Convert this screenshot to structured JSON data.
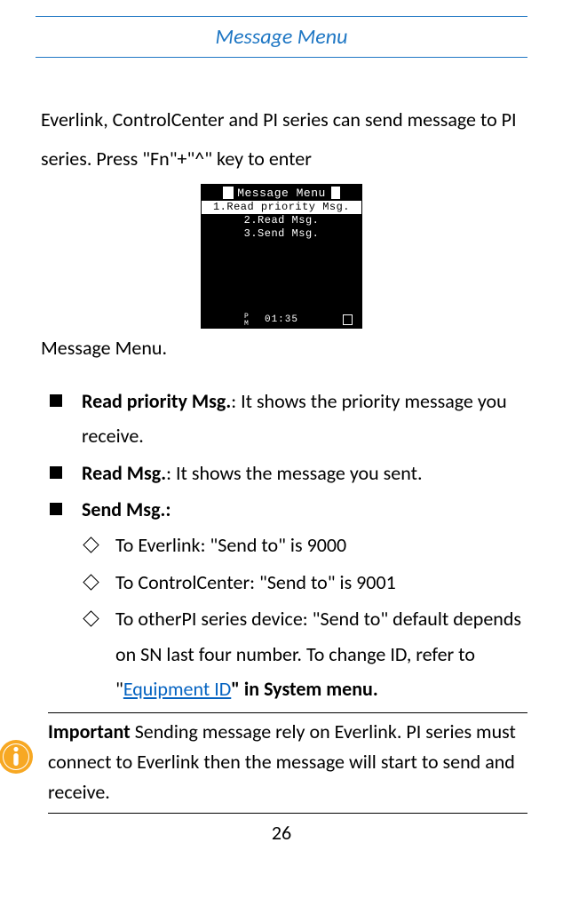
{
  "heading": "Message Menu",
  "intro": "Everlink, ControlCenter and PI series can send message to PI series. Press \"Fn\"+\"^\" key to enter",
  "screen": {
    "title": "Message Menu",
    "row1": "1.Read priority Msg.",
    "row2": "2.Read Msg.",
    "row3": "3.Send Msg.",
    "time": "01:35"
  },
  "caption": "Message Menu.",
  "list": {
    "item1_title": "Read priority Msg.",
    "item1_desc": ": It shows the priority message you receive.",
    "item2_title": "Read Msg.",
    "item2_desc": ": It shows the message you sent.",
    "item3_title": "Send Msg.:",
    "sub1": "To Everlink: \"Send to\" is 9000",
    "sub2": "To ControlCenter: \"Send to\" is 9001",
    "sub3_a": "To otherPI series device: \"Send to\" default depends on SN last four number. To change ID, refer to \"",
    "sub3_link": "Equipment ID",
    "sub3_b": "\" in System menu."
  },
  "note": {
    "label": "Important",
    "text": "    Sending message rely on Everlink. PI series must connect to Everlink then the message will start to send and receive."
  },
  "page_number": "26"
}
